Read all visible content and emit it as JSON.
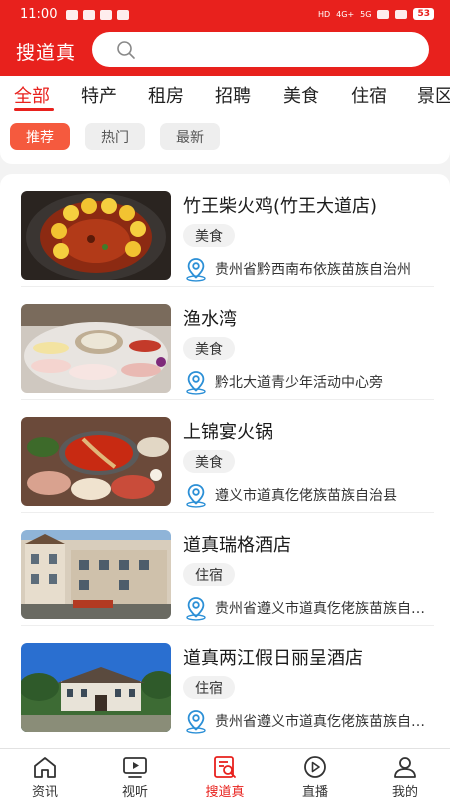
{
  "status_bar": {
    "time": "11:00",
    "battery": "53",
    "signal_text": [
      "HD",
      "4G+",
      "5G"
    ]
  },
  "header": {
    "brand": "搜道真"
  },
  "categories": [
    "全部",
    "特产",
    "租房",
    "招聘",
    "美食",
    "住宿",
    "景区"
  ],
  "active_category": "全部",
  "filters": [
    "推荐",
    "热门",
    "最新"
  ],
  "active_filter": "推荐",
  "items": [
    {
      "title": "竹王柴火鸡(竹王大道店)",
      "tag": "美食",
      "address": "贵州省黔西南布依族苗族自治州",
      "thumb": "spicy-chicken-pot-photo"
    },
    {
      "title": "渔水湾",
      "tag": "美食",
      "address": "黔北大道青少年活动中心旁",
      "thumb": "fish-hotpot-table-photo"
    },
    {
      "title": "上锦宴火锅",
      "tag": "美食",
      "address": "遵义市道真仡佬族苗族自治县",
      "thumb": "red-hotpot-spread-photo"
    },
    {
      "title": "道真瑞格酒店",
      "tag": "住宿",
      "address": "贵州省遵义市道真仡佬族苗族自治县",
      "thumb": "hotel-building-photo"
    },
    {
      "title": "道真两江假日丽呈酒店",
      "tag": "住宿",
      "address": "贵州省遵义市道真仡佬族苗族自治县",
      "thumb": "resort-hotel-photo"
    }
  ],
  "bottom_nav": [
    {
      "label": "资讯",
      "icon": "home-icon"
    },
    {
      "label": "视听",
      "icon": "tv-play-icon"
    },
    {
      "label": "搜道真",
      "icon": "search-doc-icon"
    },
    {
      "label": "直播",
      "icon": "live-play-icon"
    },
    {
      "label": "我的",
      "icon": "user-icon"
    }
  ],
  "active_nav": "搜道真",
  "colors": {
    "brand_red": "#e8211d",
    "pill_active": "#f55a3e",
    "pin_blue": "#2b8fd6"
  }
}
